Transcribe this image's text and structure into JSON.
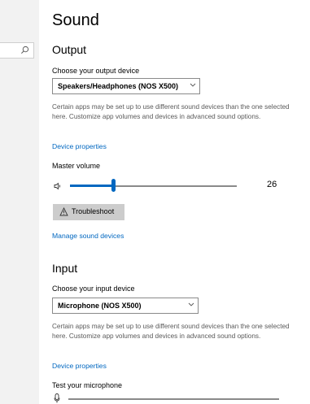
{
  "search": {
    "icon": "search-icon"
  },
  "page": {
    "title": "Sound"
  },
  "output": {
    "section_title": "Output",
    "device_label": "Choose your output device",
    "device_value": "Speakers/Headphones (NOS X500)",
    "help_text": "Certain apps may be set up to use different sound devices than the one selected here. Customize app volumes and devices in advanced sound options.",
    "device_properties_link": "Device properties",
    "master_volume_label": "Master volume",
    "volume": 26,
    "volume_text": "26",
    "troubleshoot_label": "Troubleshoot",
    "manage_devices_link": "Manage sound devices"
  },
  "input": {
    "section_title": "Input",
    "device_label": "Choose your input device",
    "device_value": "Microphone (NOS X500)",
    "help_text": "Certain apps may be set up to use different sound devices than the one selected here. Customize app volumes and devices in advanced sound options.",
    "device_properties_link": "Device properties",
    "test_label": "Test your microphone"
  },
  "colors": {
    "accent": "#0067c0",
    "button_bg": "#cccccc",
    "pane_bg": "#f2f2f2"
  }
}
